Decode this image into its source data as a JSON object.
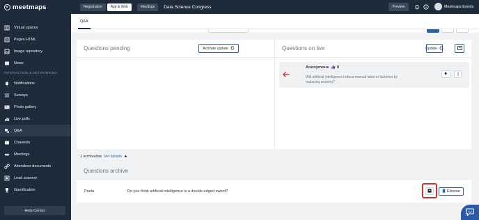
{
  "brand": {
    "name": "meetmaps"
  },
  "sidebar": {
    "items_top": [
      {
        "label": "Virtual spaces",
        "icon": "book-icon"
      },
      {
        "label": "Pages HTML",
        "icon": "html-icon"
      },
      {
        "label": "Image repository",
        "icon": "image-icon"
      },
      {
        "label": "News",
        "icon": "news-icon"
      }
    ],
    "section_label": "INTERACTION & NETWORKING",
    "items_bottom": [
      {
        "label": "Notifications",
        "icon": "bell-icon"
      },
      {
        "label": "Surveys",
        "icon": "list-icon"
      },
      {
        "label": "Photo gallery",
        "icon": "photo-icon"
      },
      {
        "label": "Live polls",
        "icon": "chart-icon"
      },
      {
        "label": "Q&A",
        "icon": "qa-icon"
      },
      {
        "label": "Channels",
        "icon": "channels-icon"
      },
      {
        "label": "Meetings",
        "icon": "handshake-icon"
      },
      {
        "label": "Attendees documents",
        "icon": "link-icon"
      },
      {
        "label": "Lead scanner",
        "icon": "scanner-icon"
      },
      {
        "label": "Gamification",
        "icon": "trophy-icon"
      }
    ],
    "help_label": "Help Center"
  },
  "topbar": {
    "tabs": [
      "Registration",
      "App & Web",
      "Meetings"
    ],
    "event_title": "Data Science Congress",
    "preview_label": "Preview",
    "user_name": "Meetmaps Events"
  },
  "subtabs": {
    "active": "Q&A"
  },
  "pending": {
    "title": "Questions pending",
    "activate_label": "Activate update"
  },
  "live": {
    "title": "Questions on live",
    "update_label": "Update",
    "question": {
      "author": "Anonymous",
      "likes": "0",
      "text": "Will artificial intelligence reduce manual labor in factories by replacing workers?"
    }
  },
  "archive": {
    "count_text": "1 archivadas",
    "link_text": "Ver listado",
    "title": "Questions archive",
    "row": {
      "author": "Paola",
      "text": "Do you think artificial intelligence is a double-edged sword?",
      "delete_label": "Eliminar"
    }
  },
  "colors": {
    "sidebar_bg": "#1d2b3a",
    "accent": "#2a5fa8",
    "highlight": "#d32f2f",
    "like": "#7b4bb7",
    "arrow": "#d04040"
  }
}
